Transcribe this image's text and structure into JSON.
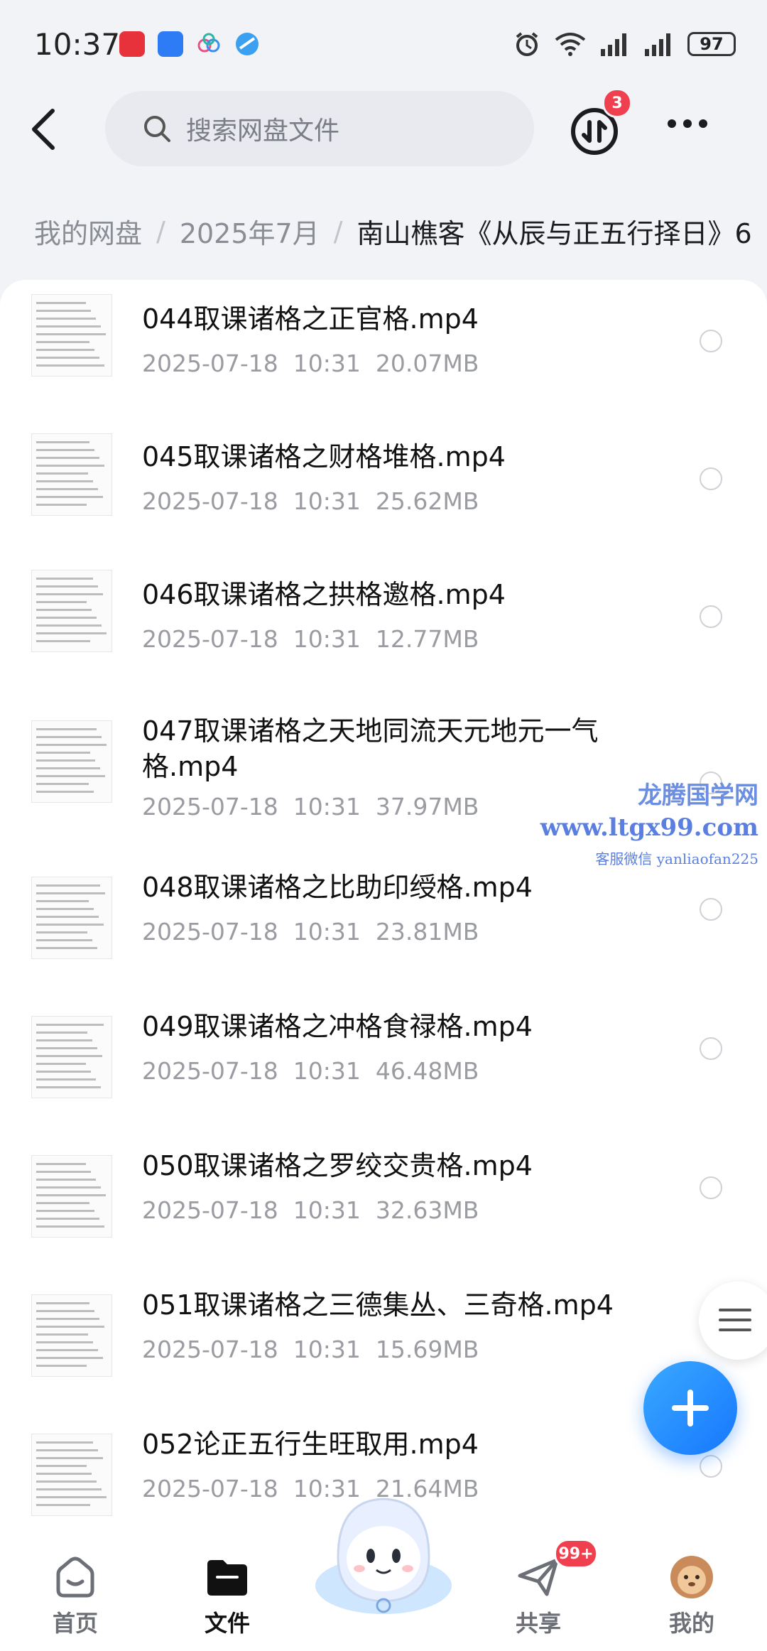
{
  "status_bar": {
    "time": "10:37",
    "battery": "97",
    "icons": [
      "huawei-app-icon",
      "shield-app-icon",
      "cloud-app-icon",
      "browser-app-icon",
      "alarm-icon",
      "wifi-icon",
      "signal-icon",
      "signal-icon"
    ]
  },
  "header": {
    "search_placeholder": "搜索网盘文件",
    "transfer_badge": "3"
  },
  "breadcrumb": [
    "我的网盘",
    "2025年7月",
    "南山樵客《从辰与正五行择日》6"
  ],
  "files": [
    {
      "name": "044取课诸格之正官格.mp4",
      "date": "2025-07-18",
      "time": "10:31",
      "size": "20.07MB"
    },
    {
      "name": "045取课诸格之财格堆格.mp4",
      "date": "2025-07-18",
      "time": "10:31",
      "size": "25.62MB"
    },
    {
      "name": "046取课诸格之拱格邀格.mp4",
      "date": "2025-07-18",
      "time": "10:31",
      "size": "12.77MB"
    },
    {
      "name": "047取课诸格之天地同流天元地元一气格.mp4",
      "date": "2025-07-18",
      "time": "10:31",
      "size": "37.97MB"
    },
    {
      "name": "048取课诸格之比助印绶格.mp4",
      "date": "2025-07-18",
      "time": "10:31",
      "size": "23.81MB"
    },
    {
      "name": "049取课诸格之冲格食禄格.mp4",
      "date": "2025-07-18",
      "time": "10:31",
      "size": "46.48MB"
    },
    {
      "name": "050取课诸格之罗绞交贵格.mp4",
      "date": "2025-07-18",
      "time": "10:31",
      "size": "32.63MB"
    },
    {
      "name": "051取课诸格之三德集丛、三奇格.mp4",
      "date": "2025-07-18",
      "time": "10:31",
      "size": "15.69MB"
    },
    {
      "name": "052论正五行生旺取用.mp4",
      "date": "2025-07-18",
      "time": "10:31",
      "size": "21.64MB"
    }
  ],
  "watermark": {
    "line1": "龙腾国学网",
    "line2": "www.ltgx99.com",
    "line3": "客服微信 yanliaofan225"
  },
  "bottom_nav": {
    "home": "首页",
    "files": "文件",
    "share": "共享",
    "share_badge": "99+",
    "mine": "我的"
  },
  "colors": {
    "accent": "#1677ff",
    "badge": "#f04050",
    "background": "#f2f3f7"
  }
}
